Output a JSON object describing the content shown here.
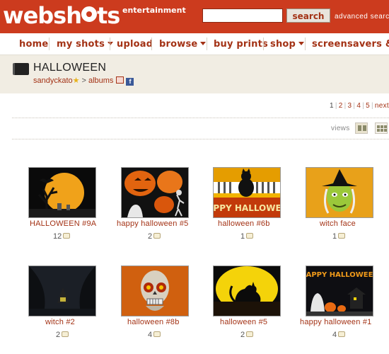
{
  "header": {
    "logo": "webshots",
    "tagline": "entertainment",
    "search_placeholder": "",
    "search_button": "search",
    "advanced_search": "advanced search"
  },
  "nav": {
    "items": [
      {
        "label": "home",
        "dropdown": false
      },
      {
        "label": "my shots",
        "dropdown": true
      },
      {
        "label": "upload",
        "dropdown": false
      },
      {
        "label": "browse",
        "dropdown": true
      },
      {
        "label": "buy prints",
        "dropdown": false
      },
      {
        "label": "shop",
        "dropdown": true
      },
      {
        "label": "screensavers & w",
        "dropdown": false
      }
    ]
  },
  "album": {
    "title": "HALLOWEEN",
    "user": "sandyckato",
    "separator": ">",
    "albums_link": "albums"
  },
  "pagination": {
    "pages": [
      "1",
      "2",
      "3",
      "4",
      "5"
    ],
    "next": "next"
  },
  "view_switch": {
    "label": "views"
  },
  "photos": [
    {
      "title": "HALLOWEEN #9A",
      "comments": "12"
    },
    {
      "title": "happy halloween #5",
      "comments": "2"
    },
    {
      "title": "halloween #6b",
      "comments": "1"
    },
    {
      "title": "witch face",
      "comments": "1"
    },
    {
      "title": "witch #2",
      "comments": "2"
    },
    {
      "title": "halloween #8b",
      "comments": "4"
    },
    {
      "title": "halloween #5",
      "comments": "2"
    },
    {
      "title": "happy halloween #1",
      "comments": "4"
    }
  ],
  "thumbnail_text": {
    "photo3_banner": "HAPPY HALLOWEEN",
    "photo8_banner": "HAPPY HALLOWEEN"
  },
  "colors": {
    "brand_red": "#cc3b1e",
    "link_red": "#a33215",
    "header_bg": "#f1ede3"
  }
}
